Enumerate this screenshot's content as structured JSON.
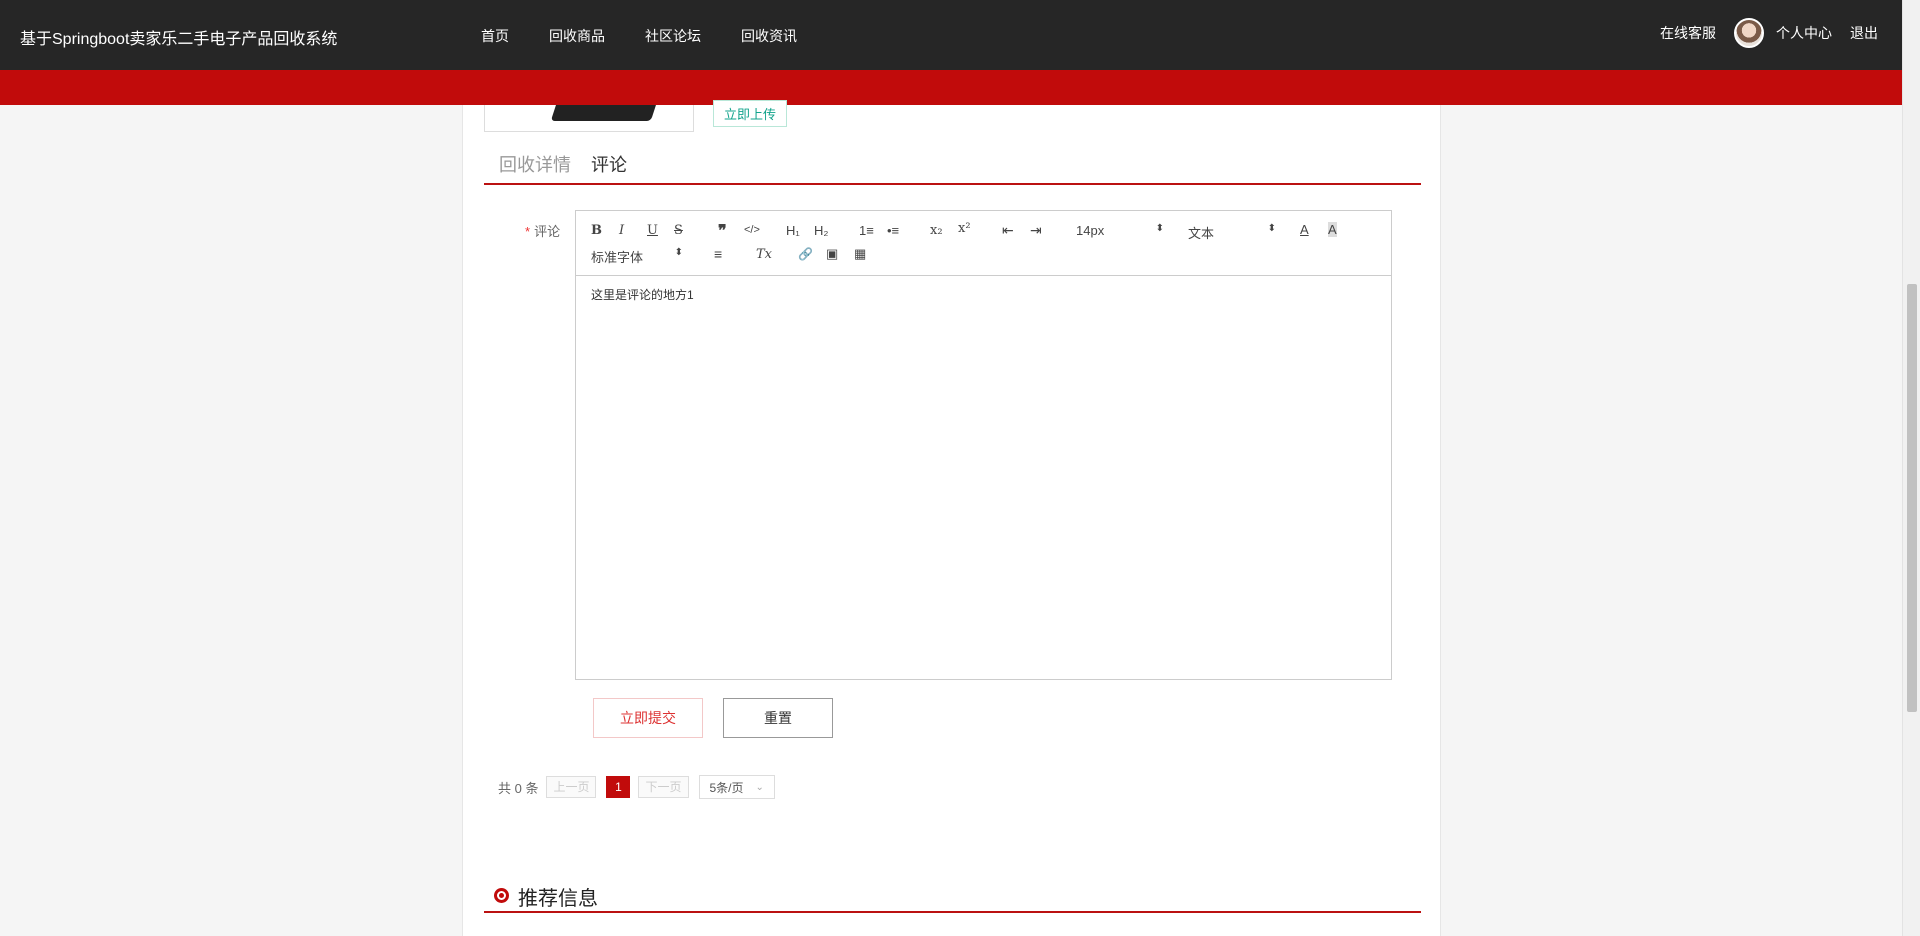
{
  "header": {
    "brand": "基于Springboot卖家乐二手电子产品回收系统",
    "nav": [
      "首页",
      "回收商品",
      "社区论坛",
      "回收资讯"
    ],
    "right": {
      "service": "在线客服",
      "profile": "个人中心",
      "logout": "退出"
    }
  },
  "upload": {
    "label": "立即上传"
  },
  "tabs": {
    "detail": "回收详情",
    "comment": "评论"
  },
  "form": {
    "label": "评论",
    "required_mark": "*",
    "toolbar": {
      "bold": "B",
      "italic": "I",
      "underline": "U",
      "strike": "S",
      "quote": "❞",
      "code": "</>",
      "h1": "H₁",
      "h2": "H₂",
      "ordered": "1≡",
      "bullet": "•≡",
      "sub": "x₂",
      "sup": "x²",
      "outdent": "⇤",
      "indent": "⇥",
      "size": "14px",
      "text": "文本",
      "font": "标准字体",
      "color": "A",
      "bg": "A",
      "align": "≡",
      "clear": "Tx",
      "link": "🔗",
      "image": "▣",
      "video": "▦"
    },
    "content": "这里是评论的地方1",
    "submit": "立即提交",
    "reset": "重置"
  },
  "pager": {
    "total": "共 0 条",
    "prev": "上一页",
    "current": "1",
    "next": "下一页",
    "size": "5条/页"
  },
  "recommend": {
    "title": "推荐信息"
  }
}
